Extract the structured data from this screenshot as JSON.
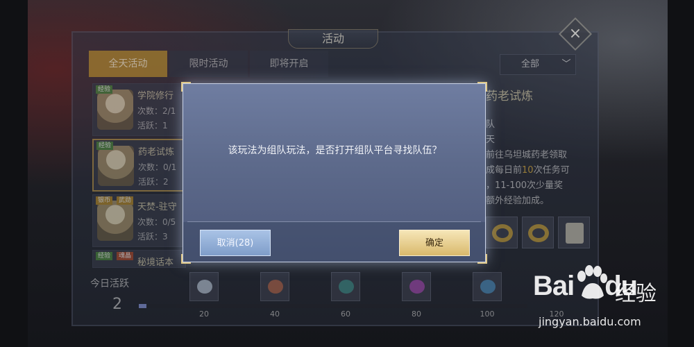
{
  "panel": {
    "title": "活动",
    "close_icon": "×",
    "tabs": [
      {
        "label": "全天活动",
        "active": true
      },
      {
        "label": "限时活动",
        "active": false
      },
      {
        "label": "即将开启",
        "active": false
      }
    ],
    "filter": {
      "value": "全部",
      "icon": "chevron-down-icon",
      "glyph": "﹀"
    },
    "activities": [
      {
        "tags": [
          "经验"
        ],
        "name": "学院修行",
        "count": "次数：2/1",
        "active_pts": "活跃：1"
      },
      {
        "tags": [
          "经验"
        ],
        "name": "药老试炼",
        "count": "次数：0/1",
        "active_pts": "活跃：2",
        "selected": true
      },
      {
        "tags": [
          "银币",
          "武勋"
        ],
        "name": "天焚-驻守",
        "count": "次数：0/5",
        "active_pts": "活跃：3"
      },
      {
        "tags": [
          "经验",
          "魂晶"
        ],
        "name": "秘境话本"
      }
    ],
    "detail": {
      "name": "药老试炼",
      "lines": [
        "队",
        "天",
        "前往乌坦城药老领取",
        "成每日前",
        "次任务可",
        "，11-100次少量奖",
        "额外经验加成。"
      ],
      "highlight": "10"
    },
    "daily": {
      "label": "今日活跃",
      "value": "2",
      "progress": 0.02,
      "milestones": [
        "20",
        "40",
        "60",
        "80",
        "100",
        "120"
      ]
    }
  },
  "modal": {
    "message": "该玩法为组队玩法，是否打开组队平台寻找队伍？",
    "cancel_label": "取消(28)",
    "confirm_label": "确定"
  },
  "watermark": {
    "logo_text": "Bai",
    "logo_du": "du",
    "brand_cn": "经验",
    "url": "jingyan.baidu.com"
  },
  "colors": {
    "accent_gold": "#b58a2c",
    "modal_bg": "#5d6a8b",
    "confirm_btn": "#d9b96c",
    "cancel_btn": "#7f9dc9"
  }
}
